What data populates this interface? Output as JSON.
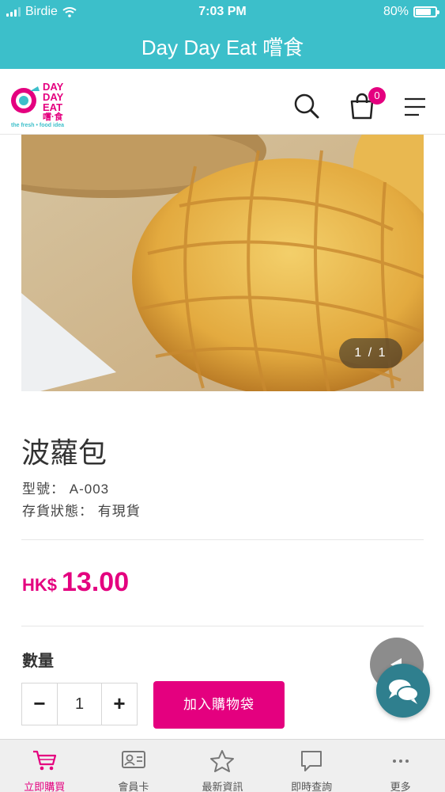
{
  "status_bar": {
    "carrier": "Birdie",
    "time": "7:03 PM",
    "battery": "80%",
    "battery_level": 0.8
  },
  "app_title": "Day Day Eat 嚐食",
  "header": {
    "logo_words": [
      "DAY",
      "DAY",
      "EAT"
    ],
    "logo_chinese": "嚐·食",
    "logo_tagline": "the fresh • food idea",
    "cart_count": "0",
    "icons": [
      "search-icon",
      "shopping-bag-icon",
      "menu-icon"
    ]
  },
  "product": {
    "image_counter": "1 / 1",
    "name": "波蘿包",
    "model_label": "型號：",
    "model_value": "A-003",
    "stock_label": "存貨狀態：",
    "stock_value": "有現貨",
    "currency": "HK$",
    "price": "13.00"
  },
  "quantity": {
    "label": "數量",
    "minus": "−",
    "value": "1",
    "plus": "+"
  },
  "add_to_bag": "加入購物袋",
  "tabs": [
    {
      "label": "立即購買",
      "icon": "cart-icon",
      "active": true
    },
    {
      "label": "會員卡",
      "icon": "member-card-icon",
      "active": false
    },
    {
      "label": "最新資訊",
      "icon": "star-icon",
      "active": false
    },
    {
      "label": "即時查詢",
      "icon": "chat-bubble-icon",
      "active": false
    },
    {
      "label": "更多",
      "icon": "more-dots-icon",
      "active": false
    }
  ],
  "colors": {
    "teal": "#3cbfca",
    "magenta": "#e4007f",
    "chat_button": "#2f7f8e"
  }
}
